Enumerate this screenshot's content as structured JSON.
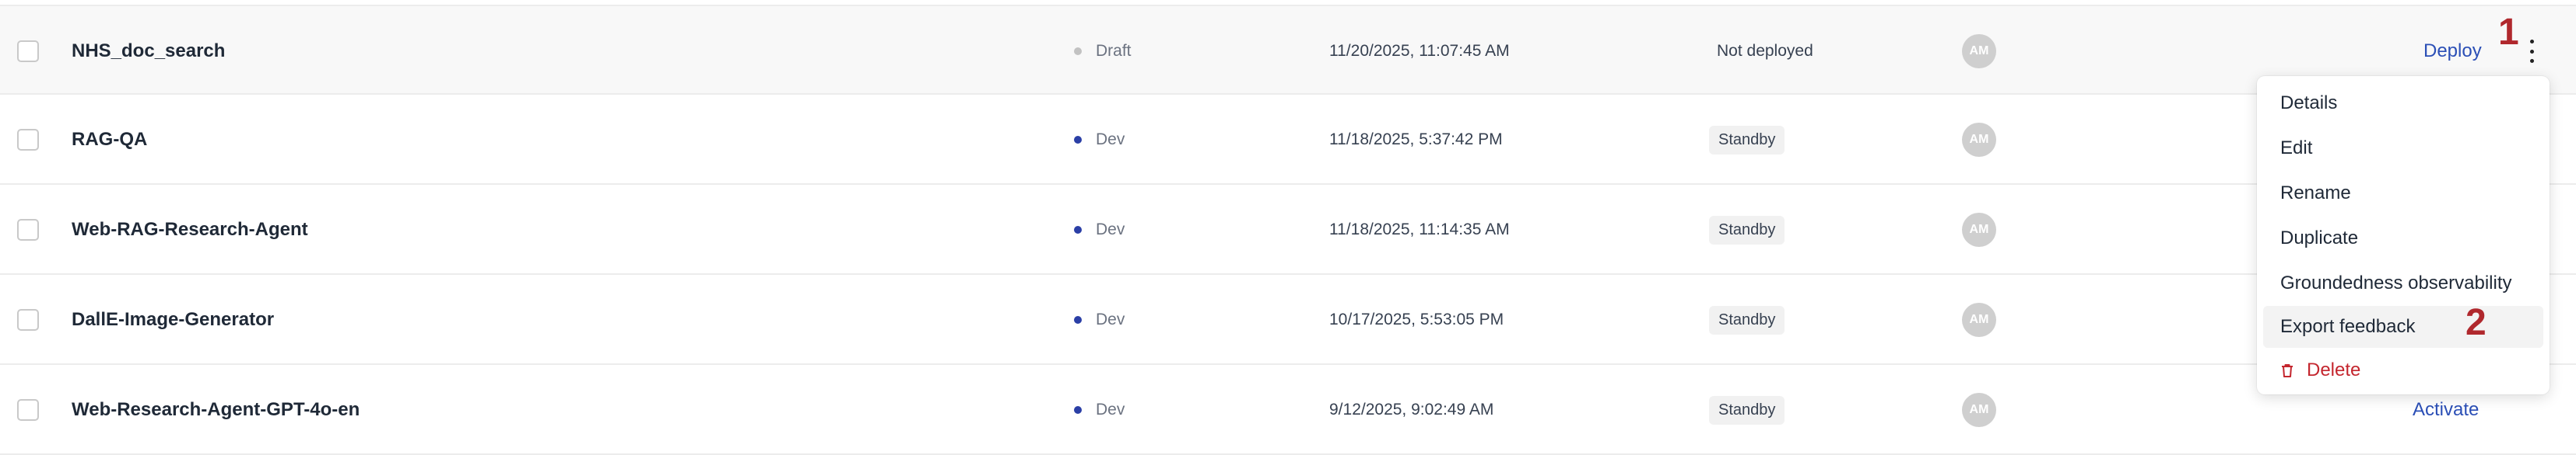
{
  "rows": [
    {
      "name": "NHS_doc_search",
      "status": "Draft",
      "status_color": "#c2c2c2",
      "date": "11/20/2025, 11:07:45 AM",
      "deployment": "Not deployed",
      "avatar": "AM",
      "action": "Deploy"
    },
    {
      "name": "RAG-QA",
      "status": "Dev",
      "status_color": "#2b3fa6",
      "date": "11/18/2025, 5:37:42 PM",
      "deployment": "Standby",
      "avatar": "AM"
    },
    {
      "name": "Web-RAG-Research-Agent",
      "status": "Dev",
      "status_color": "#2b3fa6",
      "date": "11/18/2025, 11:14:35 AM",
      "deployment": "Standby",
      "avatar": "AM"
    },
    {
      "name": "DallE-Image-Generator",
      "status": "Dev",
      "status_color": "#2b3fa6",
      "date": "10/17/2025, 5:53:05 PM",
      "deployment": "Standby",
      "avatar": "AM"
    },
    {
      "name": "Web-Research-Agent-GPT-4o-en",
      "status": "Dev",
      "status_color": "#2b3fa6",
      "date": "9/12/2025, 9:02:49 AM",
      "deployment": "Standby",
      "avatar": "AM",
      "action": "Activate"
    }
  ],
  "menu": {
    "items": [
      "Details",
      "Edit",
      "Rename",
      "Duplicate",
      "Groundedness observability",
      "Export feedback"
    ],
    "delete_label": "Delete",
    "delete_icon": "trash-icon"
  },
  "annotations": {
    "first": "1",
    "second": "2"
  },
  "colors": {
    "link": "#2b4fb6",
    "danger": "#c4262e",
    "annotation": "#b0282d"
  }
}
